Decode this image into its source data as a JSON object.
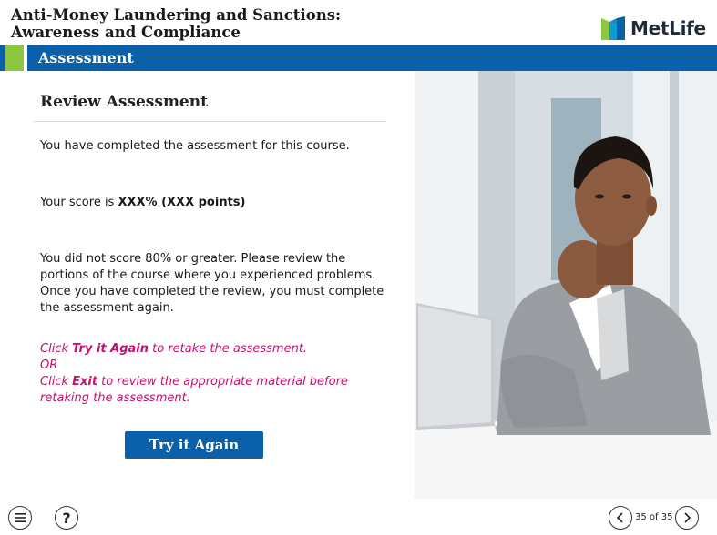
{
  "header": {
    "course_title": "Anti-Money Laundering and Sanctions: Awareness and Compliance",
    "logo_text": "MetLife"
  },
  "section": {
    "title": "Assessment"
  },
  "main": {
    "heading": "Review Assessment",
    "completed_text": "You have completed the assessment for this course.",
    "score_prefix": "Your score is ",
    "score_value": "XXX% (XXX points)",
    "result_text": "You did not score 80% or greater. Please review the portions of the course where you experienced problems. Once you have completed the review, you must complete the assessment again.",
    "instr_click1": "Click ",
    "instr_bold1": "Try it Again",
    "instr_rest1": " to retake the assessment.",
    "instr_or": "OR",
    "instr_click2": "Click ",
    "instr_bold2": "Exit",
    "instr_rest2": " to review the appropriate material before retaking the assessment.",
    "try_again_label": "Try it Again"
  },
  "footer": {
    "page_indicator": "35 of 35",
    "help_glyph": "?"
  },
  "icons": {
    "menu": "menu-icon",
    "help": "help-icon",
    "prev": "chevron-left-icon",
    "next": "chevron-right-icon"
  },
  "colors": {
    "brand_blue": "#0a61a9",
    "brand_green": "#8dc63f",
    "instruction_magenta": "#c0136e"
  }
}
